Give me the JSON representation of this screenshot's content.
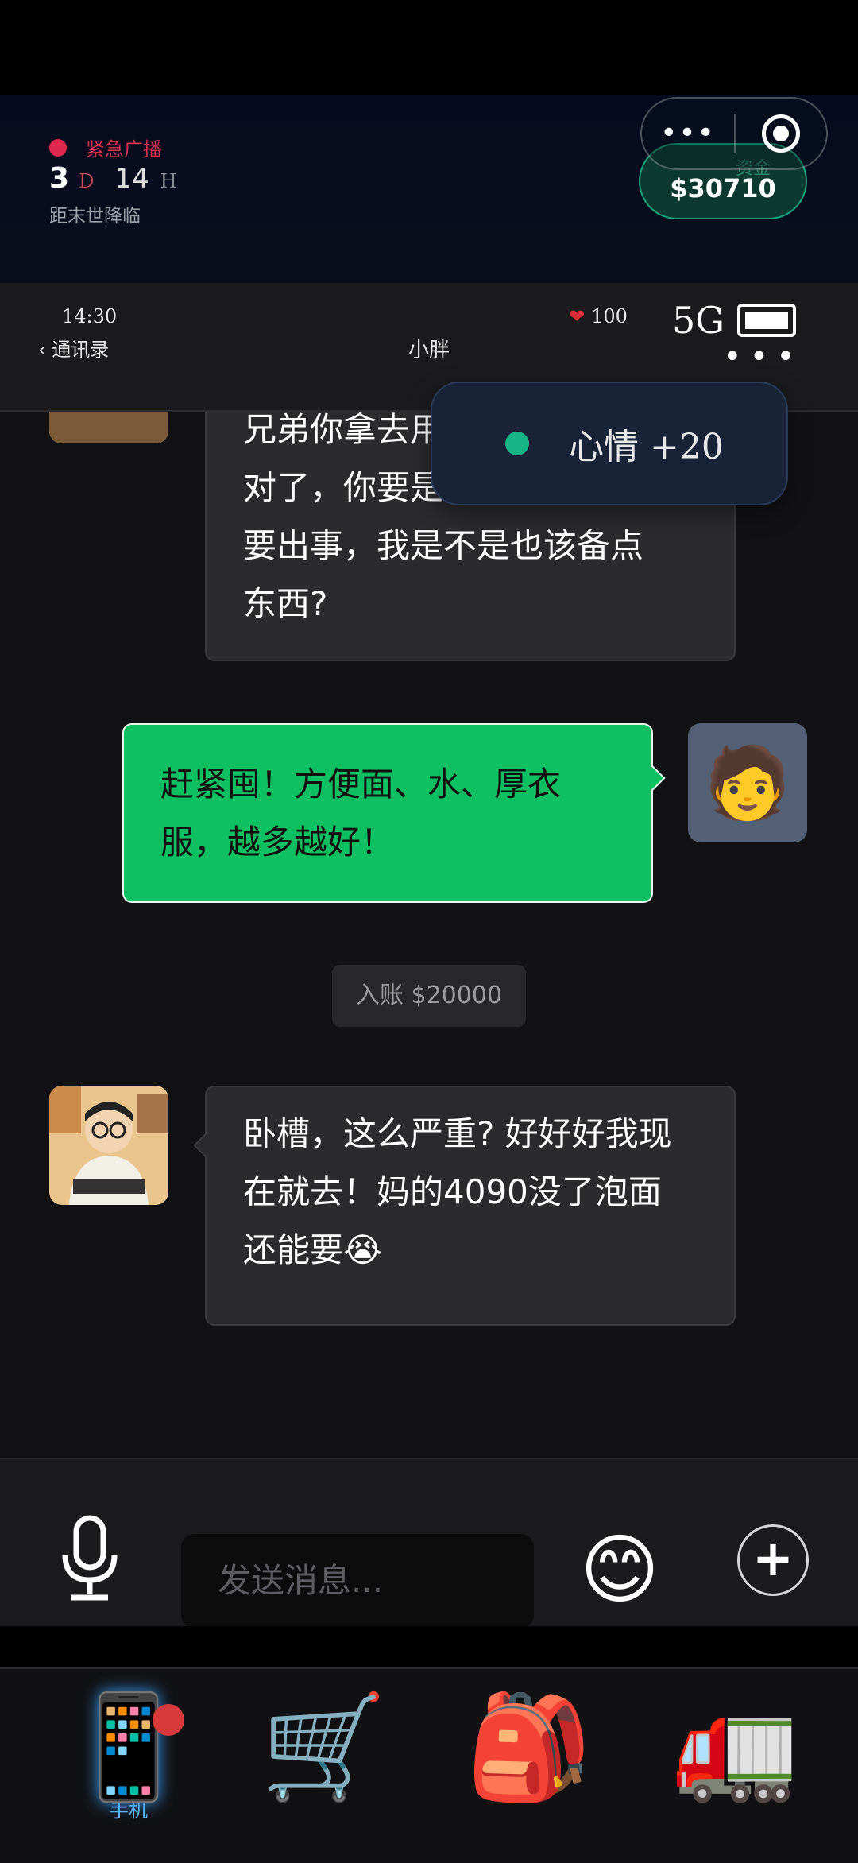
{
  "hud": {
    "alert_label": "紧急广播",
    "days": "3",
    "days_unit": "D",
    "hours": "14",
    "hours_unit": "H",
    "subtitle": "距末世降临",
    "funds_label": "资金",
    "funds_value": "$30710"
  },
  "capsule": {
    "more": "•••"
  },
  "phonebar": {
    "time": "14:30",
    "back_label": "通讯录",
    "title": "小胖",
    "health": "100",
    "signal": "5G"
  },
  "messages": {
    "m1": [
      "兄弟你拿去用",
      "对了，你要是说真",
      "要出事，我是不是也该备点",
      "东西?"
    ],
    "m2": [
      "赶紧囤！方便面、水、厚衣",
      "服，越多越好！"
    ],
    "system": "入账 $20000",
    "m3": [
      "卧槽，这么严重? 好好好我现",
      "在就去！妈的4090没了泡面",
      "还能要😭"
    ]
  },
  "toast": {
    "text": "心情 +20"
  },
  "composer": {
    "placeholder": "发送消息...",
    "emoji": "😊",
    "plus": "+"
  },
  "tabs": [
    {
      "icon": "📱",
      "label": "手机"
    },
    {
      "icon": "🛒",
      "label": ""
    },
    {
      "icon": "🎒",
      "label": ""
    },
    {
      "icon": "🚛",
      "label": ""
    }
  ],
  "colors": {
    "accent_green": "#0fc063",
    "alert_red": "#e0284e",
    "funds_green": "#19a47a"
  },
  "avatars": {
    "user": "🧑"
  }
}
